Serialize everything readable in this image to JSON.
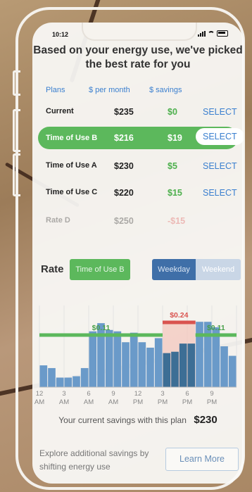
{
  "status_bar": {
    "time": "10:12"
  },
  "headline": "Based on your energy use, we've picked the best rate for you",
  "columns": {
    "plans": "Plans",
    "per_month": "$ per month",
    "savings": "$ savings"
  },
  "plans": [
    {
      "name": "Current",
      "cost": "$235",
      "savings": "$0",
      "action": "SELECT",
      "selected": false
    },
    {
      "name": "Time of Use B",
      "cost": "$216",
      "savings": "$19",
      "action": "SELECT",
      "selected": true
    },
    {
      "name": "Time of Use A",
      "cost": "$230",
      "savings": "$5",
      "action": "SELECT",
      "selected": false
    },
    {
      "name": "Time of Use C",
      "cost": "$220",
      "savings": "$15",
      "action": "SELECT",
      "selected": false
    },
    {
      "name": "Rate D",
      "cost": "$250",
      "savings": "-$15",
      "action": "",
      "selected": false
    }
  ],
  "rate_section": {
    "label": "Rate",
    "selected_plan": "Time of Use B",
    "toggle": {
      "weekday": "Weekday",
      "weekend": "Weekend",
      "active": "weekday"
    }
  },
  "chart_data": {
    "type": "bar",
    "x_tick_labels": [
      [
        "12",
        "AM"
      ],
      [
        "3",
        "AM"
      ],
      [
        "6",
        "AM"
      ],
      [
        "9",
        "AM"
      ],
      [
        "12",
        "PM"
      ],
      [
        "3",
        "PM"
      ],
      [
        "6",
        "PM"
      ],
      [
        "9",
        "PM"
      ]
    ],
    "hourly_usage": [
      0.16,
      0.14,
      0.07,
      0.07,
      0.08,
      0.14,
      0.41,
      0.47,
      0.42,
      0.41,
      0.33,
      0.4,
      0.33,
      0.29,
      0.36,
      0.25,
      0.26,
      0.32,
      0.32,
      0.48,
      0.48,
      0.44,
      0.3,
      0.23
    ],
    "peak_hours": [
      15,
      16,
      17,
      18
    ],
    "rate_lines": [
      {
        "label": "$0.11",
        "from_hour": 0,
        "to_hour": 15,
        "color": "#5cb85c"
      },
      {
        "label": "$0.24",
        "from_hour": 15,
        "to_hour": 19,
        "color": "#d9534f"
      },
      {
        "label": "$0.11",
        "from_hour": 19,
        "to_hour": 24,
        "color": "#5cb85c"
      }
    ],
    "colors": {
      "bar": "#6a9ac9",
      "peak_bar": "#3d6e95",
      "peak_band": "#f3c4bb"
    }
  },
  "savings_summary": {
    "text": "Your current savings with this plan",
    "value": "$230"
  },
  "explore": {
    "text": "Explore additional savings by shifting energy use",
    "button": "Learn More"
  },
  "colors": {
    "accent_green": "#5cb85c",
    "accent_blue": "#3a7fcf",
    "peak_red": "#d9534f"
  }
}
